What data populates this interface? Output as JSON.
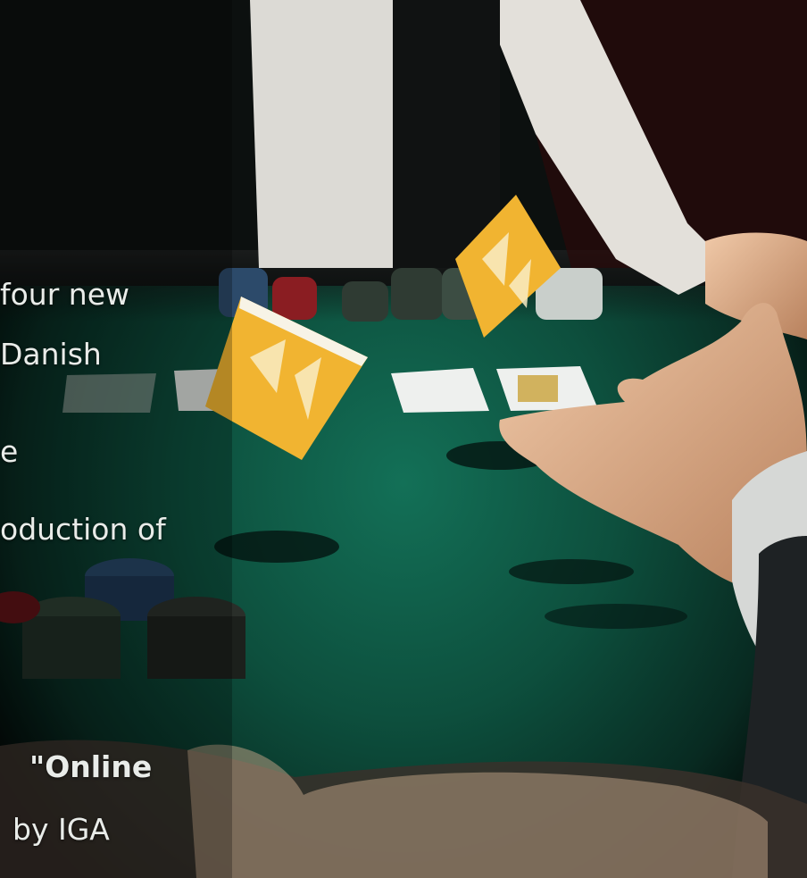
{
  "text_fragments": {
    "line1": "four new",
    "line2": "Danish",
    "line3": "e",
    "line4": "oduction of",
    "line5": "\"Online",
    "line6": "by IGA"
  },
  "colors": {
    "felt": "#0f5a45",
    "card_yellow": "#f1b431",
    "shirt": "#e7e4df",
    "text": "#e9ece9"
  }
}
